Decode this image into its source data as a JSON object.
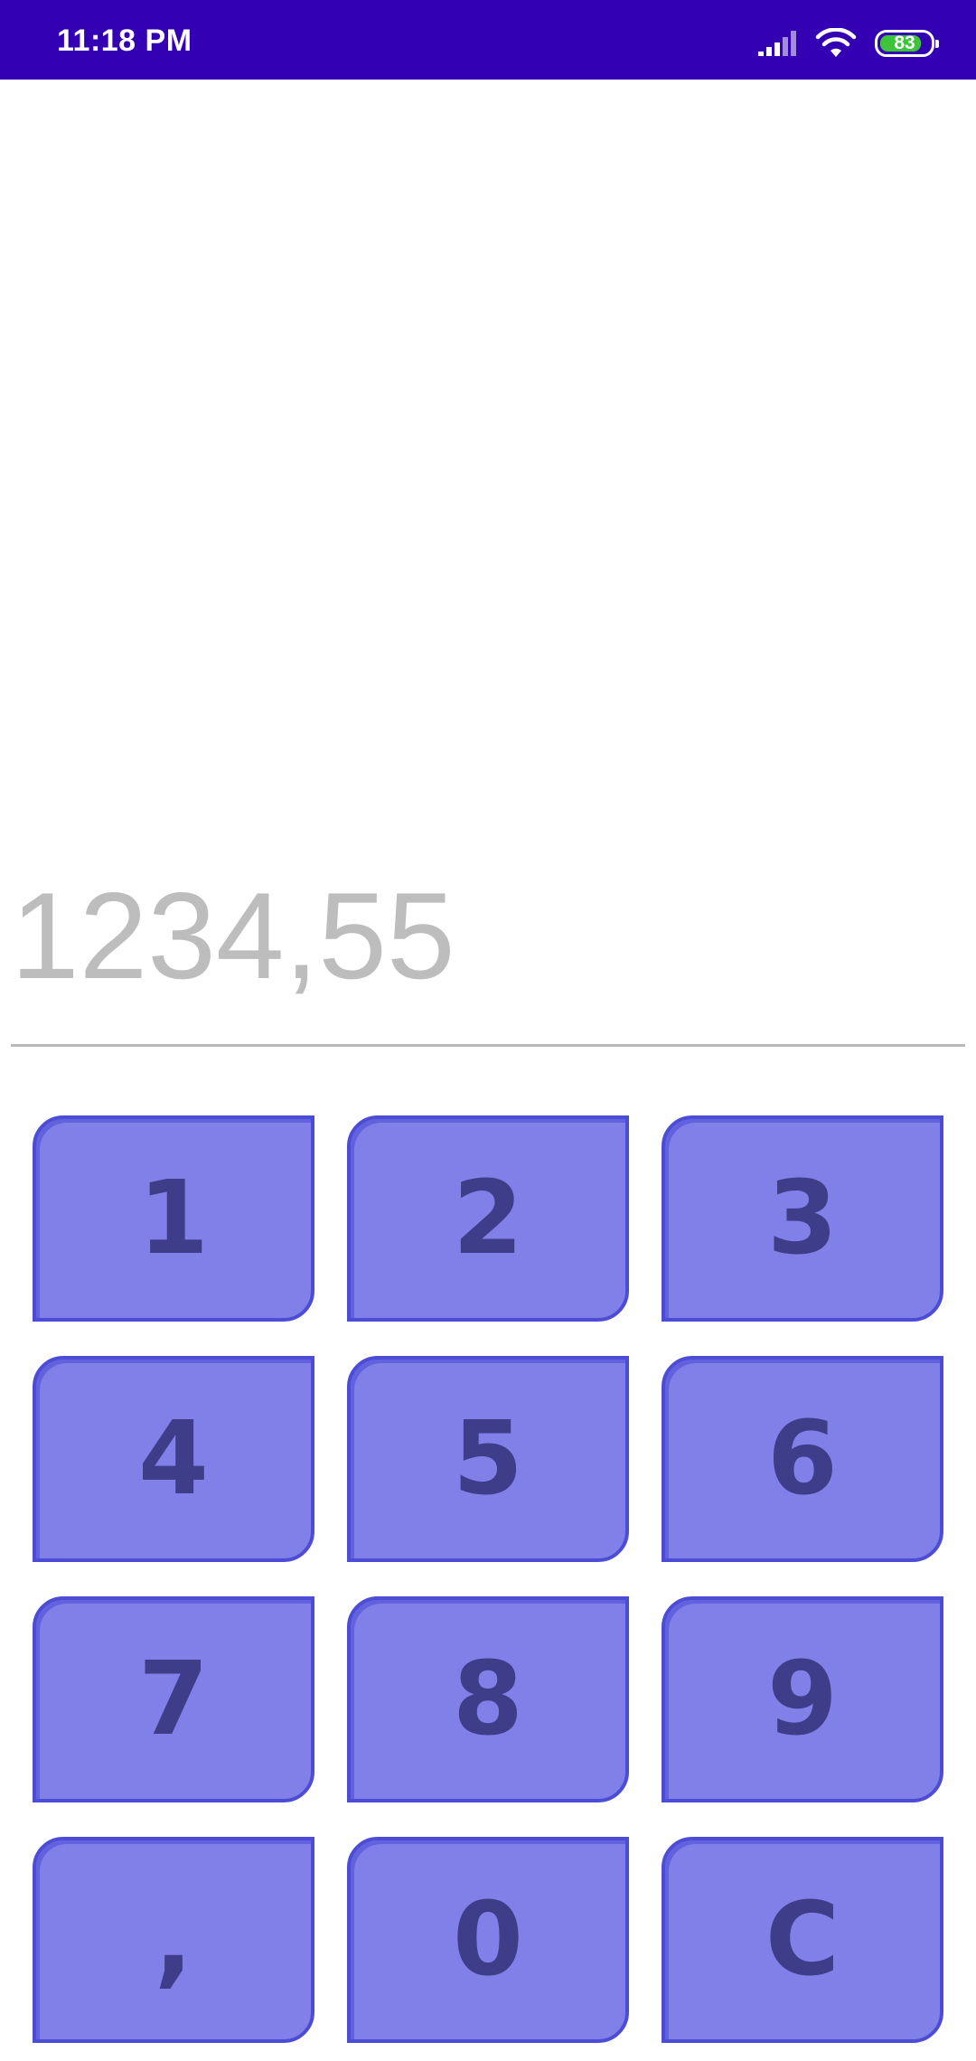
{
  "status_bar": {
    "time": "11:18 PM",
    "battery_level": "83",
    "battery_fraction": 0.83,
    "icons": [
      "signal-icon",
      "wifi-icon",
      "battery-icon"
    ],
    "background_color": "#3300b3",
    "battery_color": "#3ec43a"
  },
  "display": {
    "placeholder": "1234,55",
    "value": ""
  },
  "keypad": {
    "keys": [
      "1",
      "2",
      "3",
      "4",
      "5",
      "6",
      "7",
      "8",
      "9",
      ",",
      "0",
      "C"
    ],
    "key_color": "#8080e8",
    "key_border_color": "#4c4cd6",
    "key_text_color": "#3d3d8a"
  }
}
